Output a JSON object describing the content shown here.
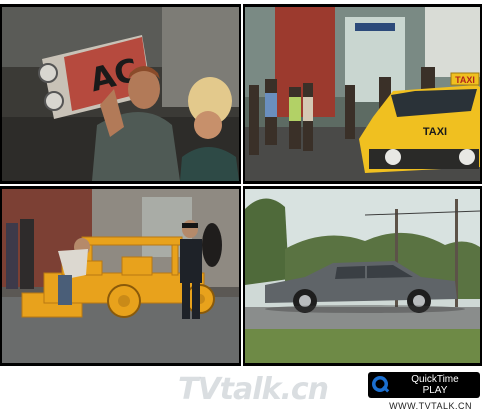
{
  "frames": [
    {
      "id": "top-left",
      "scene": "man carrying cardboard prop on shoulder"
    },
    {
      "id": "top-right",
      "scene": "yellow taxi on busy street",
      "sign_text": "TAXI"
    },
    {
      "id": "bottom-left",
      "scene": "yellow block car beside officer"
    },
    {
      "id": "bottom-right",
      "scene": "grey sedan parked on grass lane"
    }
  ],
  "taxi_sign": "TAXI",
  "watermark": "TVtalk.cn",
  "quicktime": {
    "brand": "QuickTime",
    "action": "PLAY"
  },
  "site_url": "WWW.TVTALK.CN",
  "colors": {
    "taxi_yellow": "#f0c020",
    "block_orange": "#e8a21c",
    "sedan_grey": "#5f6468"
  }
}
